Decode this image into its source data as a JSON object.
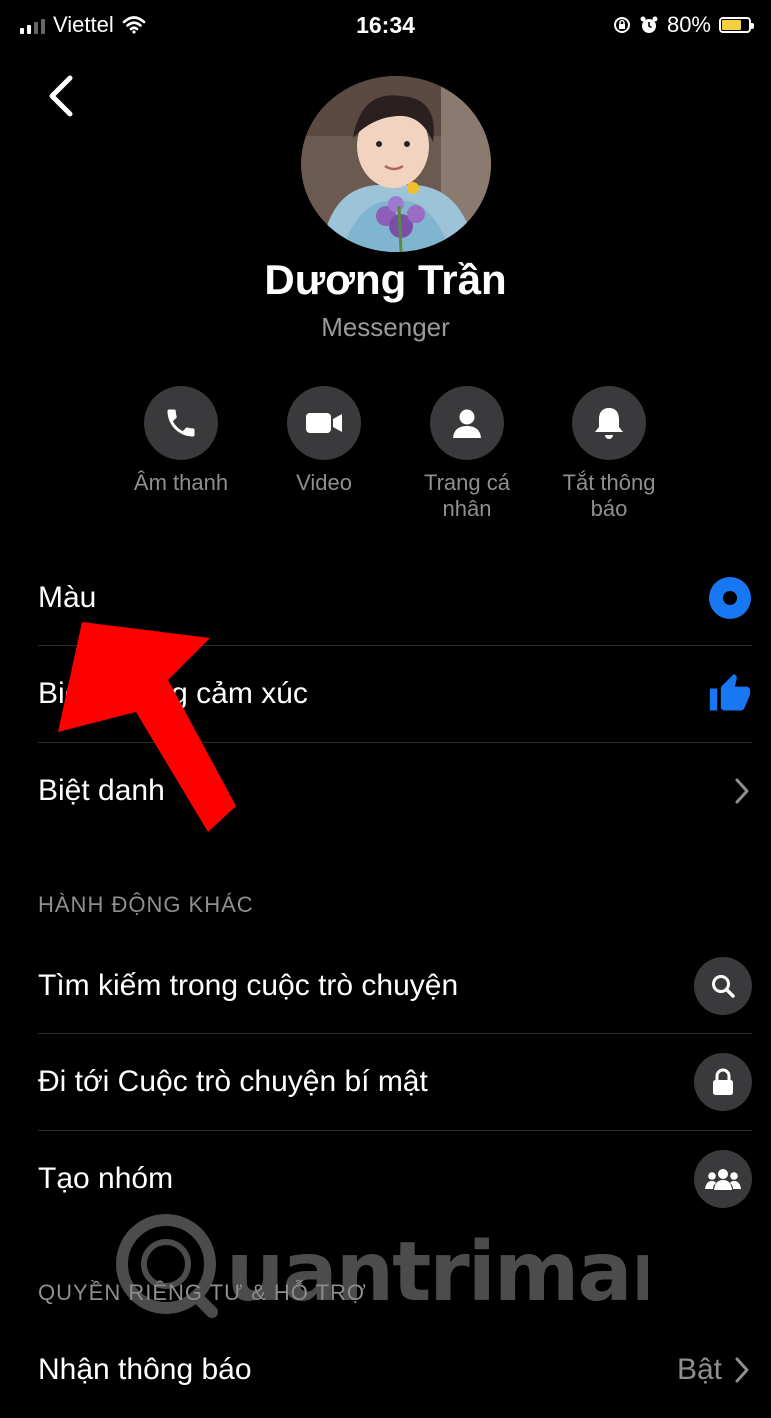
{
  "status_bar": {
    "carrier": "Viettel",
    "time": "16:34",
    "battery": "80%",
    "battery_level": 0.8
  },
  "profile": {
    "name": "Dương Trần",
    "subtitle": "Messenger"
  },
  "actions": [
    {
      "label": "Âm thanh",
      "icon": "phone-icon"
    },
    {
      "label": "Video",
      "icon": "video-camera-icon"
    },
    {
      "label": "Trang cá nhân",
      "icon": "person-icon"
    },
    {
      "label": "Tắt thông báo",
      "icon": "bell-icon"
    }
  ],
  "settings": [
    {
      "label": "Màu",
      "icon": "color-circle-icon"
    },
    {
      "label": "Biểu tượng cảm xúc",
      "icon": "thumbs-up-icon"
    },
    {
      "label": "Biệt danh",
      "icon": "chevron-right-icon"
    }
  ],
  "other_actions": {
    "header": "HÀNH ĐỘNG KHÁC",
    "items": [
      {
        "label": "Tìm kiếm trong cuộc trò chuyện",
        "icon": "search-icon"
      },
      {
        "label": "Đi tới Cuộc trò chuyện bí mật",
        "icon": "lock-icon"
      },
      {
        "label": "Tạo nhóm",
        "icon": "group-icon"
      }
    ]
  },
  "privacy": {
    "header": "QUYỀN RIÊNG TƯ & HỖ TRỢ",
    "items": [
      {
        "label": "Nhận thông báo",
        "value": "Bật",
        "icon": "chevron-right-icon"
      }
    ]
  },
  "watermark": "Quantrimang",
  "colors": {
    "background": "#000000",
    "accent": "#1877f2",
    "secondary_text": "#8e8e93",
    "arrow": "#ff0000",
    "battery": "#f4d03f"
  }
}
